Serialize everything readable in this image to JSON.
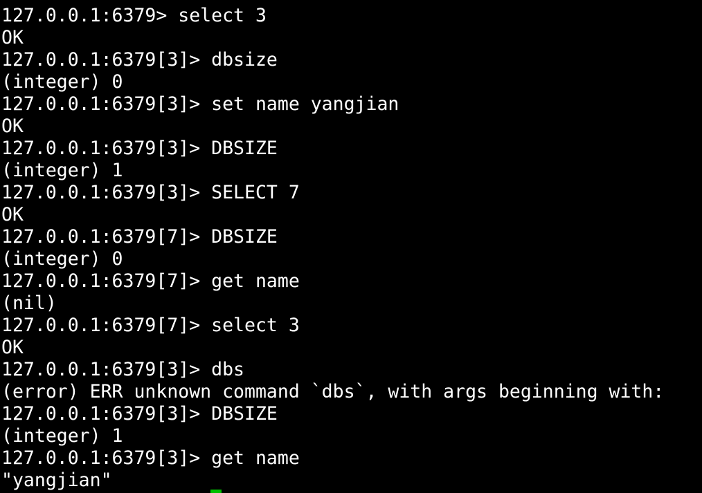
{
  "terminal": {
    "lines": [
      "127.0.0.1:6379> select 3",
      "OK",
      "127.0.0.1:6379[3]> dbsize",
      "(integer) 0",
      "127.0.0.1:6379[3]> set name yangjian",
      "OK",
      "127.0.0.1:6379[3]> DBSIZE",
      "(integer) 1",
      "127.0.0.1:6379[3]> SELECT 7",
      "OK",
      "127.0.0.1:6379[7]> DBSIZE",
      "(integer) 0",
      "127.0.0.1:6379[7]> get name",
      "(nil)",
      "127.0.0.1:6379[7]> select 3",
      "OK",
      "127.0.0.1:6379[3]> dbs",
      "(error) ERR unknown command `dbs`, with args beginning with:",
      "127.0.0.1:6379[3]> DBSIZE",
      "(integer) 1",
      "127.0.0.1:6379[3]> get name",
      "\"yangjian\""
    ]
  },
  "colors": {
    "background": "#000000",
    "foreground": "#ffffff",
    "cursor": "#00c000"
  }
}
